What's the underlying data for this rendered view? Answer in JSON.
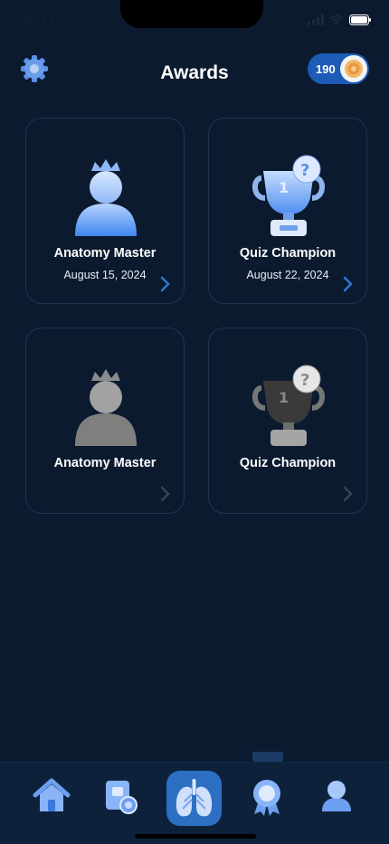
{
  "status": {
    "time": "9:41"
  },
  "header": {
    "title": "Awards",
    "coins": "190"
  },
  "awards": [
    {
      "name": "Anatomy Master",
      "date": "August 15, 2024",
      "icon": "crowned-person-icon",
      "earned": true
    },
    {
      "name": "Quiz Champion",
      "date": "August 22, 2024",
      "icon": "trophy-icon",
      "earned": true
    },
    {
      "name": "Anatomy Master",
      "date": "",
      "icon": "crowned-person-icon",
      "earned": false
    },
    {
      "name": "Quiz Champion",
      "date": "",
      "icon": "trophy-icon",
      "earned": false
    }
  ],
  "tabs": [
    {
      "icon": "home-icon"
    },
    {
      "icon": "search-card-icon"
    },
    {
      "icon": "lungs-icon",
      "active": true
    },
    {
      "icon": "award-ribbon-icon"
    },
    {
      "icon": "profile-icon"
    }
  ],
  "colors": {
    "background": "#0b1a2e",
    "accent": "#2c6fc3",
    "locked": "#7a7d82"
  }
}
